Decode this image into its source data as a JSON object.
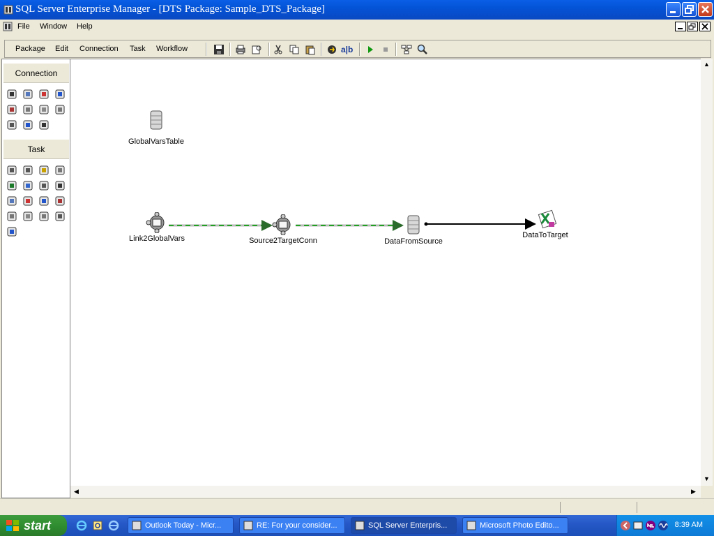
{
  "window": {
    "title": "SQL Server Enterprise Manager - [DTS Package: Sample_DTS_Package]"
  },
  "menubar": {
    "items": [
      "File",
      "Window",
      "Help"
    ]
  },
  "toolbar": {
    "menus": [
      "Package",
      "Edit",
      "Connection",
      "Task",
      "Workflow"
    ],
    "icons": [
      "save-icon",
      "print-icon",
      "print-preview-icon",
      "cut-icon",
      "copy-icon",
      "paste-icon",
      "transform-icon",
      "text-annotation-icon",
      "execute-icon",
      "stop-icon",
      "layout-icon",
      "zoom-icon"
    ]
  },
  "palette": {
    "connection_header": "Connection",
    "task_header": "Task",
    "connection_icons": [
      "sql-server-icon",
      "oledb-icon",
      "excel-icon",
      "access-icon",
      "ie-icon",
      "dbase-icon",
      "text-file-source-icon",
      "text-file-dest-icon",
      "paradox-icon",
      "odbc-icon",
      "oracle-icon"
    ],
    "task_icons": [
      "activex-task-icon",
      "ftp-task-icon",
      "transform-data-task-icon",
      "scheduler-task-icon",
      "execute-process-task-icon",
      "data-driven-query-icon",
      "copy-objects-icon",
      "bulk-insert-icon",
      "dynamic-props-icon",
      "msmq-icon",
      "send-mail-icon",
      "execute-package-icon",
      "analysis-services-icon",
      "data-mining-icon",
      "parallel-tasks-icon",
      "custom-task-icon",
      "user-task-icon"
    ]
  },
  "canvas": {
    "nodes": {
      "global_vars_table": "GlobalVarsTable",
      "link2globalvars": "Link2GlobalVars",
      "source2targetconn": "Source2TargetConn",
      "datafromsource": "DataFromSource",
      "datatotarget": "DataToTarget"
    }
  },
  "taskbar": {
    "start_label": "start",
    "tasks": [
      {
        "label": "Outlook Today - Micr...",
        "active": false
      },
      {
        "label": "RE: For your consider...",
        "active": false
      },
      {
        "label": "SQL Server Enterpris...",
        "active": true
      },
      {
        "label": "Microsoft Photo Edito...",
        "active": false
      }
    ],
    "clock": "8:39 AM"
  }
}
